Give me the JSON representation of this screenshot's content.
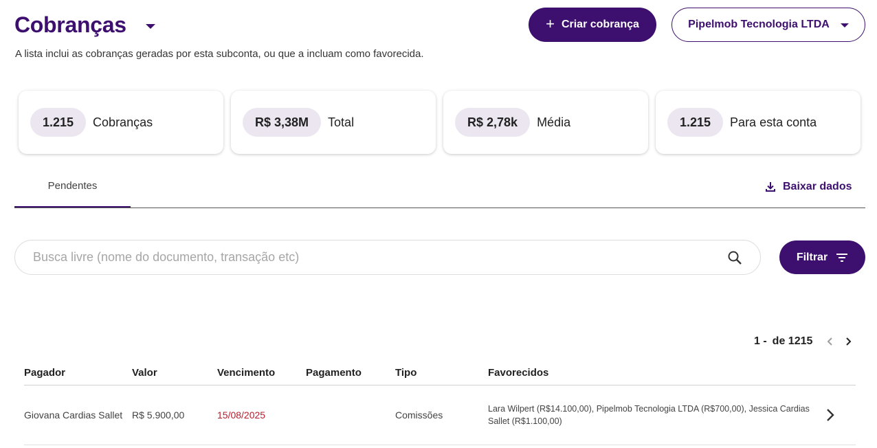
{
  "header": {
    "title": "Cobranças",
    "subtitle": "A lista inclui as cobranças geradas por esta subconta, ou que a incluam como favorecida.",
    "create_button": "Criar cobrança",
    "account_selector": "Pipelmob Tecnologia LTDA"
  },
  "summary_cards": [
    {
      "value": "1.215",
      "label": "Cobranças"
    },
    {
      "value": "R$ 3,38M",
      "label": "Total"
    },
    {
      "value": "R$ 2,78k",
      "label": "Média"
    },
    {
      "value": "1.215",
      "label": "Para esta conta"
    }
  ],
  "tabs": [
    {
      "label": "Pendentes",
      "active": true
    }
  ],
  "download_label": "Baixar dados",
  "search": {
    "placeholder": "Busca livre (nome do documento, transação etc)",
    "value": ""
  },
  "filter_button": "Filtrar",
  "pagination": {
    "range": "1 -",
    "total": "de 1215"
  },
  "table": {
    "columns": [
      "Pagador",
      "Valor",
      "Vencimento",
      "Pagamento",
      "Tipo",
      "Favorecidos"
    ],
    "rows": [
      {
        "pagador": "Giovana Cardias Sallet",
        "valor": "R$ 5.900,00",
        "vencimento": "15/08/2025",
        "pagamento": "",
        "tipo": "Comissões",
        "favorecidos": "Lara Wilpert (R$14.100,00), Pipelmob Tecnologia LTDA (R$700,00), Jessica Cardias Sallet (R$1.100,00)"
      }
    ]
  },
  "colors": {
    "brand": "#3d0f6e",
    "overdue": "#b71c2c",
    "pill_bg": "#ece6f0"
  },
  "icons": [
    "caret-down-icon",
    "plus-icon",
    "download-icon",
    "search-icon",
    "filter-icon",
    "chevron-left-icon",
    "chevron-right-icon"
  ]
}
